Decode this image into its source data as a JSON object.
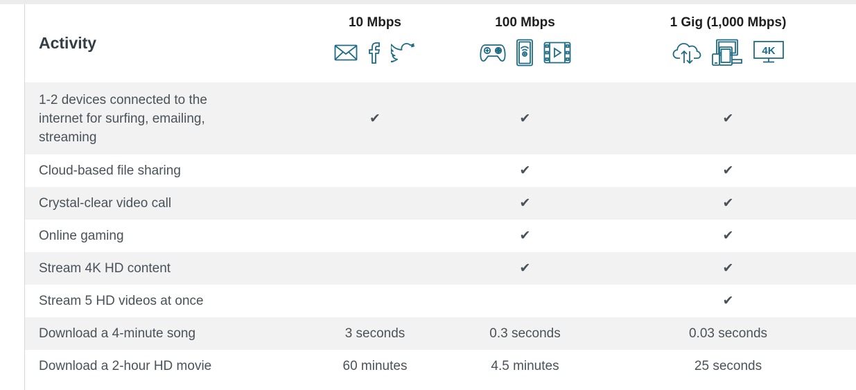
{
  "header": {
    "activity_label": "Activity",
    "speeds": [
      {
        "label": "10 Mbps",
        "icons": [
          "mail-icon",
          "facebook-icon",
          "twitter-icon"
        ]
      },
      {
        "label": "100 Mbps",
        "icons": [
          "gamepad-icon",
          "smart-speaker-icon",
          "video-icon"
        ]
      },
      {
        "label": "1 Gig (1,000 Mbps)",
        "icons": [
          "cloud-transfer-icon",
          "multi-device-icon",
          "4k-tv-icon"
        ]
      }
    ],
    "tv_badge": "4K"
  },
  "rows": [
    {
      "activity": "1-2 devices connected to the internet for surfing, emailing, streaming",
      "c1": "✔",
      "c2": "✔",
      "c3": "✔"
    },
    {
      "activity": "Cloud-based file sharing",
      "c1": "",
      "c2": "✔",
      "c3": "✔"
    },
    {
      "activity": "Crystal-clear video call",
      "c1": "",
      "c2": "✔",
      "c3": "✔"
    },
    {
      "activity": "Online gaming",
      "c1": "",
      "c2": "✔",
      "c3": "✔"
    },
    {
      "activity": "Stream 4K HD content",
      "c1": "",
      "c2": "✔",
      "c3": "✔"
    },
    {
      "activity": "Stream 5 HD videos at once",
      "c1": "",
      "c2": "",
      "c3": "✔"
    },
    {
      "activity": "Download a 4-minute song",
      "c1": "3 seconds",
      "c2": "0.3 seconds",
      "c3": "0.03 seconds"
    },
    {
      "activity": "Download a 2-hour HD movie",
      "c1": "60 minutes",
      "c2": "4.5 minutes",
      "c3": "25 seconds"
    }
  ],
  "colors": {
    "icon_stroke": "#1e6b86",
    "stripe": "#f2f2f2",
    "check": "#4c4c4c"
  }
}
